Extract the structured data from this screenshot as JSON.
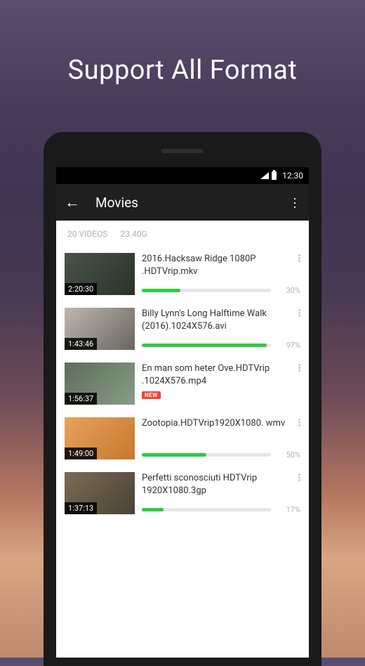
{
  "hero": {
    "title": "Support All Format"
  },
  "statusBar": {
    "time": "12:30"
  },
  "appBar": {
    "title": "Movies"
  },
  "summary": {
    "count": "20 VIDEOS",
    "size": "23.40G"
  },
  "videos": [
    {
      "title": "2016.Hacksaw Ridge 1080P .HDTVrip.mkv",
      "duration": "2:20:30",
      "progress": 30,
      "pctLabel": "30%",
      "newBadge": false
    },
    {
      "title": "Billy Lynn's Long Halftime Walk (2016).1024X576.avi",
      "duration": "1:43:46",
      "progress": 97,
      "pctLabel": "97%",
      "newBadge": false
    },
    {
      "title": "En man som heter Ove.HDTVrip .1024X576.mp4",
      "duration": "1:56:37",
      "progress": 0,
      "pctLabel": "",
      "newBadge": true
    },
    {
      "title": "Zootopia.HDTVrip1920X1080. wmv",
      "duration": "1:49:00",
      "progress": 50,
      "pctLabel": "50%",
      "newBadge": false
    },
    {
      "title": "Perfetti sconosciuti HDTVrip 1920X1080.3gp",
      "duration": "1:37:13",
      "progress": 17,
      "pctLabel": "17%",
      "newBadge": false
    }
  ],
  "labels": {
    "new": "NEW"
  }
}
